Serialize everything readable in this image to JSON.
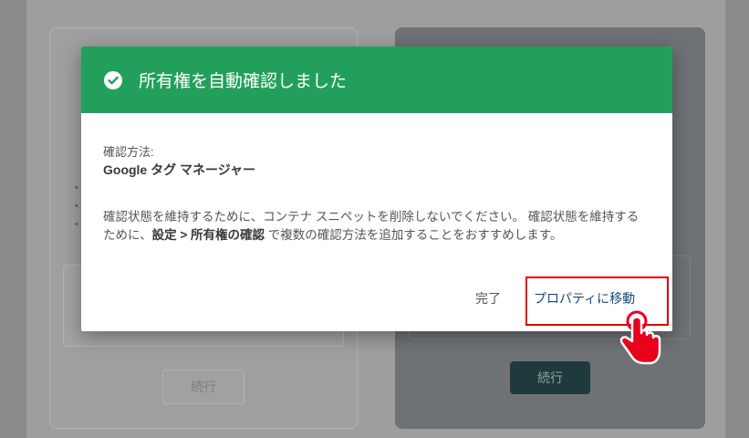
{
  "background": {
    "left_button_label": "続行",
    "right_button_label": "続行"
  },
  "dialog": {
    "title": "所有権を自動確認しました",
    "method_label": "確認方法:",
    "method_value": "Google タグ マネージャー",
    "description_part1": "確認状態を維持するために、コンテナ スニペットを削除しないでください。 確認状態を維持するために、",
    "description_bold": "設定 > 所有権の確認",
    "description_part2": " で複数の確認方法を追加することをおすすめします。",
    "done_label": "完了",
    "go_to_property_label": "プロパティに移動"
  },
  "colors": {
    "header_green": "#22a05b",
    "highlight_red": "#e00000",
    "pointer_red": "#e8001c"
  },
  "icons": {
    "header": "check-circle-icon",
    "pointer": "hand-pointer-icon"
  }
}
